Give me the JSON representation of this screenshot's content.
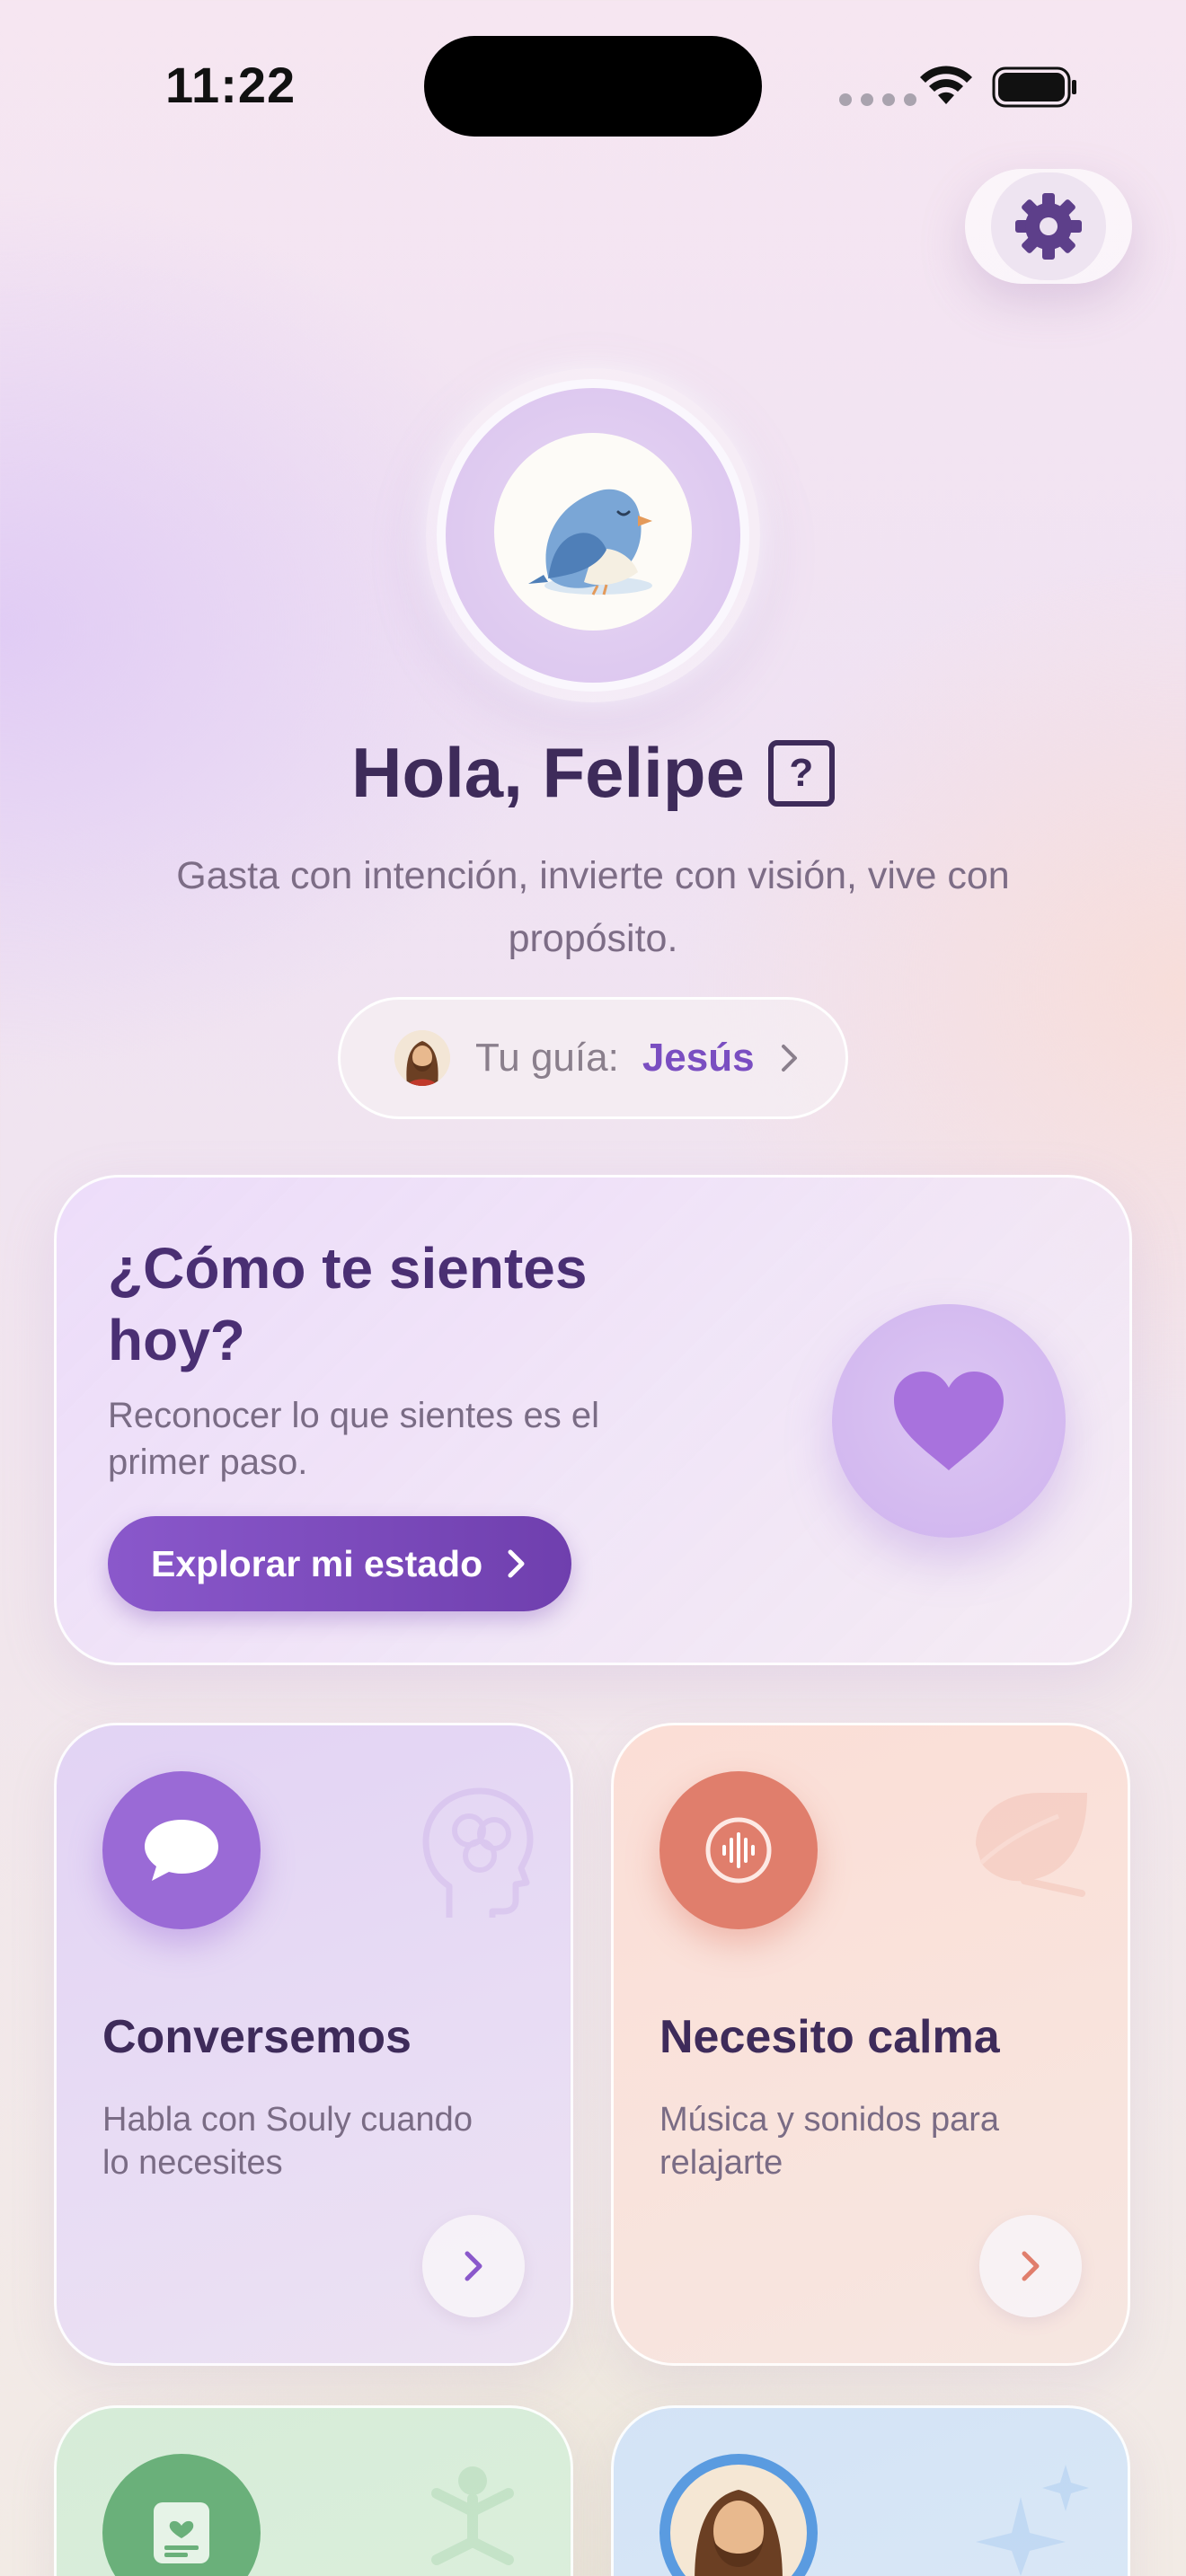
{
  "status_bar": {
    "time": "11:22"
  },
  "header": {
    "greeting": "Hola, Felipe",
    "help_symbol": "?",
    "tagline": "Gasta con intención, invierte con visión, vive con propósito."
  },
  "guide": {
    "label": "Tu guía:",
    "name": "Jesús"
  },
  "mood_card": {
    "title": "¿Cómo te sientes hoy?",
    "subtitle": "Reconocer lo que sientes es el primer paso.",
    "button_label": "Explorar mi estado"
  },
  "features": [
    {
      "title": "Conversemos",
      "subtitle": "Habla con Souly cuando lo necesites",
      "icon": "chat-bubble-icon",
      "accent": "#9a6ad6"
    },
    {
      "title": "Necesito calma",
      "subtitle": "Música y sonidos para relajarte",
      "icon": "audio-wave-icon",
      "accent": "#e07e6c"
    }
  ],
  "colors": {
    "primary_purple": "#7a4ec1",
    "coral": "#e07e6c",
    "green": "#6ab07a",
    "blue": "#5a9be0"
  }
}
